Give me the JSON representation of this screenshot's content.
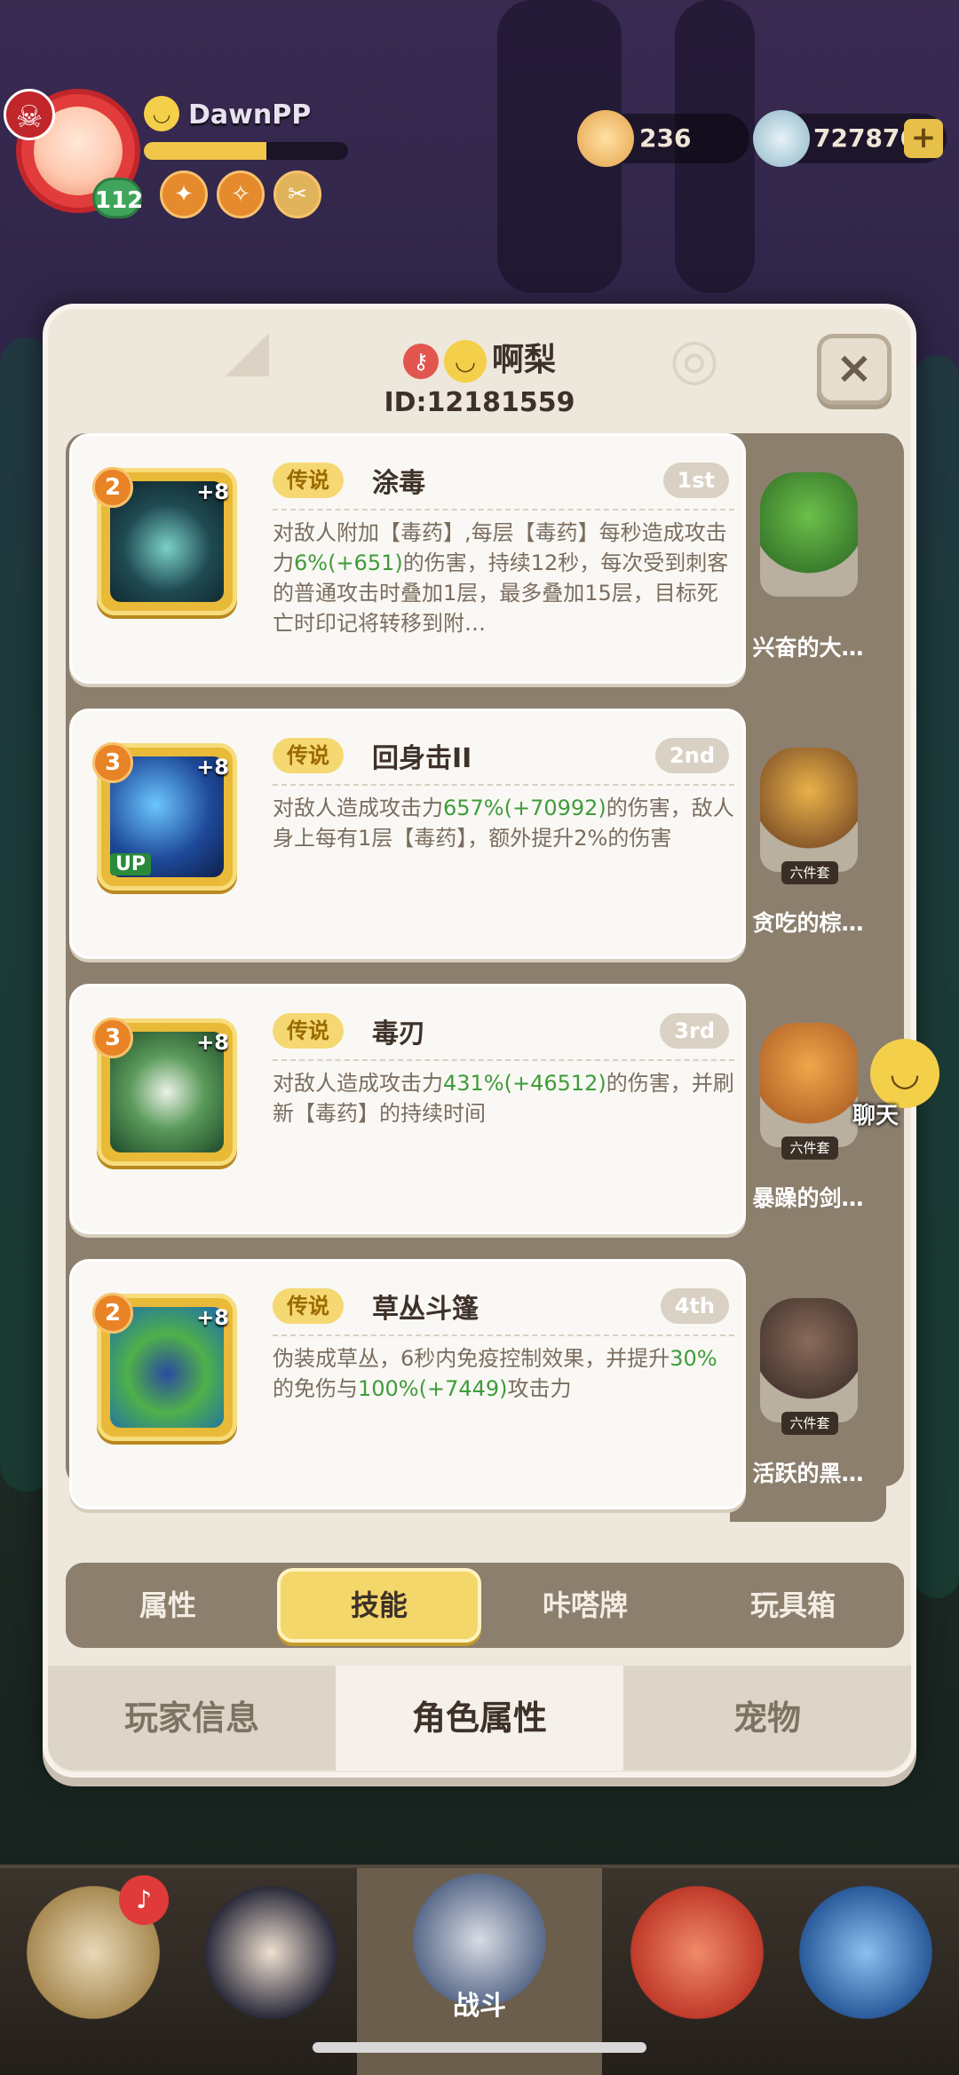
{
  "hud": {
    "player_name": "DawnPP",
    "level": "112",
    "xp_fraction": 0.6,
    "resource_1": "236",
    "resource_2": "727876"
  },
  "modal": {
    "player_title": "啊梨",
    "player_id": "ID:12181559",
    "close_glyph": "×"
  },
  "skills": [
    {
      "level": "2",
      "plus": "+8",
      "tag": "传说",
      "name": "涂毒",
      "rank": "1st",
      "icon": "poison-drop-icon",
      "desc_parts": [
        "对敌人附加【毒药】,每层【毒药】每秒造成攻击力",
        "6%(+651)",
        "的伤害，持续12秒，每次受到刺客的普通攻击时叠加1层，最多叠加15层，目标死亡时印记将转移到附…"
      ]
    },
    {
      "level": "3",
      "plus": "+8",
      "tag": "传说",
      "name": "回身击II",
      "rank": "2nd",
      "icon": "blade-slash-icon",
      "up": "UP",
      "desc_parts": [
        "对敌人造成攻击力",
        "657%(+70992)",
        "的伤害，敌人身上每有1层【毒药】，额外提升2%的伤害"
      ]
    },
    {
      "level": "3",
      "plus": "+8",
      "tag": "传说",
      "name": "毒刃",
      "rank": "3rd",
      "icon": "poison-skull-icon",
      "desc_parts": [
        "对敌人造成攻击力",
        "431%(+46512)",
        "的伤害，并刷新【毒药】的持续时间"
      ]
    },
    {
      "level": "2",
      "plus": "+8",
      "tag": "传说",
      "name": "草丛斗篷",
      "rank": "4th",
      "icon": "bush-cloak-icon",
      "desc_parts": [
        "伪装成草丛，6秒内免疫控制效果，并提升",
        "30%",
        "的免伤与",
        "100%(+7449)",
        "攻击力"
      ]
    }
  ],
  "side_pets": [
    {
      "name": "兴奋的大…",
      "badge": ""
    },
    {
      "name": "贪吃的棕…",
      "badge": "六件套"
    },
    {
      "name": "暴躁的剑…",
      "badge": "六件套"
    },
    {
      "name": "活跃的黑…",
      "badge": "六件套"
    }
  ],
  "sub_tabs": [
    "属性",
    "技能",
    "咔嗒牌",
    "玩具箱"
  ],
  "bottom_tabs": [
    "玩家信息",
    "角色属性",
    "宠物"
  ],
  "chat_label": "聊天",
  "nav": {
    "battle_label": "战斗"
  },
  "colors": {
    "accent_green": "#3f9c3a",
    "tag_yellow": "#f6d872",
    "panel": "#ede7dc"
  }
}
